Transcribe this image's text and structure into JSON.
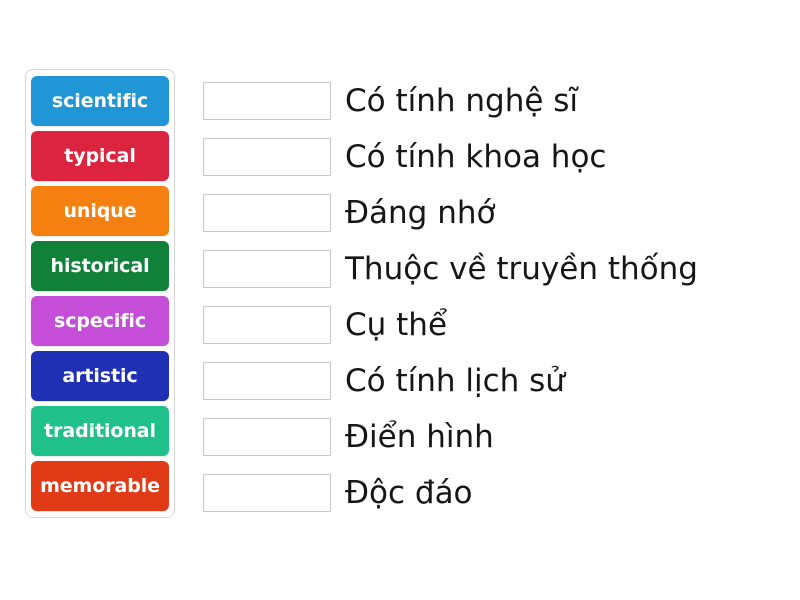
{
  "activity": {
    "type": "match-up",
    "language": "vi",
    "background_color": "#ffffff"
  },
  "word_bank": {
    "name": "word-tiles",
    "tiles": [
      {
        "label": "scientific",
        "color": "#2196d6"
      },
      {
        "label": "typical",
        "color": "#dc2340"
      },
      {
        "label": "unique",
        "color": "#f58010"
      },
      {
        "label": "historical",
        "color": "#11813a"
      },
      {
        "label": "scpecific",
        "color": "#c44ed8"
      },
      {
        "label": "artistic",
        "color": "#1f30b4"
      },
      {
        "label": "traditional",
        "color": "#1fc08a"
      },
      {
        "label": "memorable",
        "color": "#e03b16"
      }
    ]
  },
  "prompts": {
    "name": "definition-rows",
    "rows": [
      {
        "answer": "",
        "text": "Có tính nghệ sĩ"
      },
      {
        "answer": "",
        "text": "Có tính khoa học"
      },
      {
        "answer": "",
        "text": "Đáng nhớ"
      },
      {
        "answer": "",
        "text": "Thuộc về truyền thống"
      },
      {
        "answer": "",
        "text": "Cụ thể"
      },
      {
        "answer": "",
        "text": "Có tính lịch sử"
      },
      {
        "answer": "",
        "text": "Điển hình"
      },
      {
        "answer": "",
        "text": "Độc đáo"
      }
    ]
  }
}
